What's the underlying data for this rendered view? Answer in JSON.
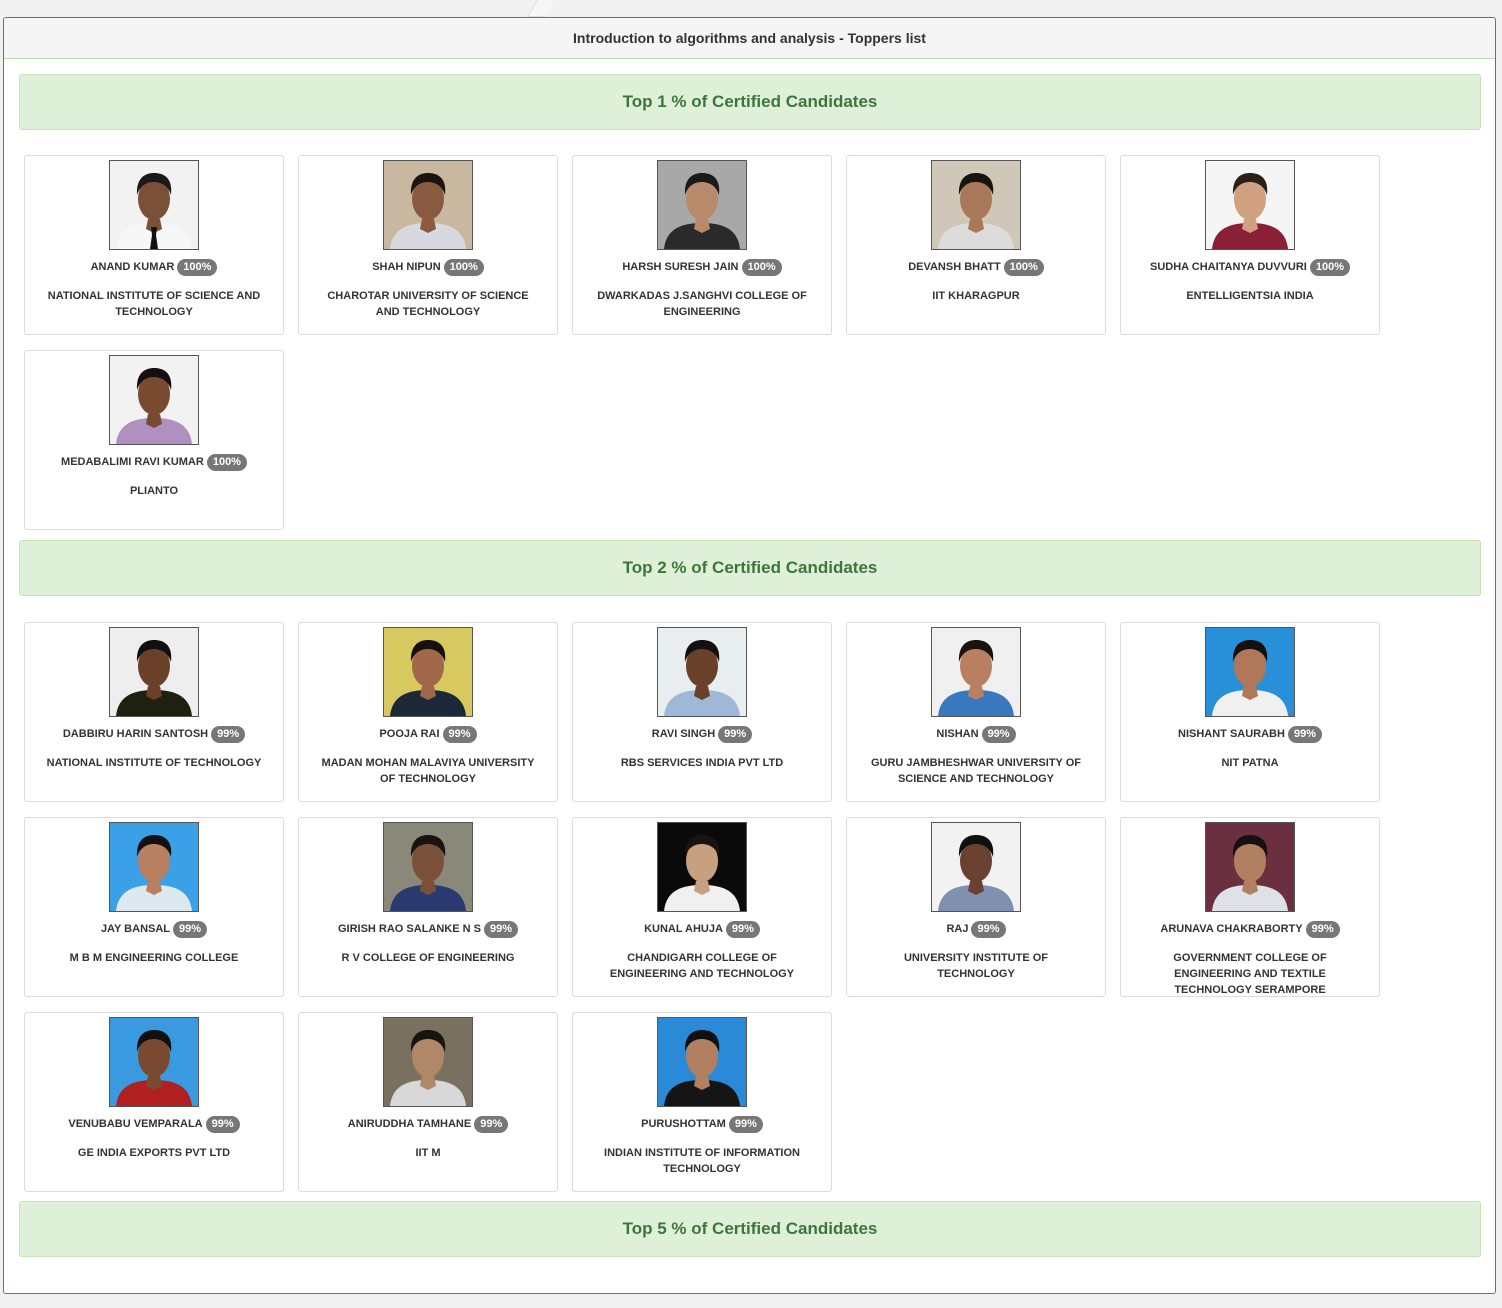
{
  "panel": {
    "title": "Introduction to algorithms and analysis - Toppers list"
  },
  "sections": [
    {
      "title": "Top 1 % of Certified Candidates",
      "candidates": [
        {
          "name": "ANAND KUMAR",
          "score": "100%",
          "org": "NATIONAL INSTITUTE OF SCIENCE AND TECHNOLOGY",
          "photo": {
            "bg": "#f2f2f2",
            "shirt": "#f7f7f7",
            "skin": "#7a5038",
            "hair": "#1a1a1a",
            "tie": true
          }
        },
        {
          "name": "SHAH NIPUN",
          "score": "100%",
          "org": "CHAROTAR UNIVERSITY OF SCIENCE AND TECHNOLOGY",
          "photo": {
            "bg": "#c9b8a0",
            "shirt": "#d8d8e0",
            "skin": "#8a5a40",
            "hair": "#1c1410",
            "tie": false
          }
        },
        {
          "name": "HARSH SURESH JAIN",
          "score": "100%",
          "org": "DWARKADAS J.SANGHVI COLLEGE OF ENGINEERING",
          "photo": {
            "bg": "#a8a8a8",
            "shirt": "#2a2a2a",
            "skin": "#b88a6a",
            "hair": "#1a1a1a",
            "tie": false
          }
        },
        {
          "name": "DEVANSH BHATT",
          "score": "100%",
          "org": "IIT KHARAGPUR",
          "photo": {
            "bg": "#cfc7b8",
            "shirt": "#dcdcdc",
            "skin": "#a87858",
            "hair": "#1a1410",
            "tie": false
          }
        },
        {
          "name": "SUDHA CHAITANYA DUVVURI",
          "score": "100%",
          "org": "ENTELLIGENTSIA INDIA",
          "photo": {
            "bg": "#f5f5f5",
            "shirt": "#8a2035",
            "skin": "#d0a080",
            "hair": "#2a2018",
            "tie": false
          }
        },
        {
          "name": "MEDABALIMI RAVI KUMAR",
          "score": "100%",
          "org": "PLIANTO",
          "photo": {
            "bg": "#f2f2f2",
            "shirt": "#b090c0",
            "skin": "#7a4a30",
            "hair": "#141010",
            "tie": false
          }
        }
      ]
    },
    {
      "title": "Top 2 % of Certified Candidates",
      "candidates": [
        {
          "name": "DABBIRU HARIN SANTOSH",
          "score": "99%",
          "org": "NATIONAL INSTITUTE OF TECHNOLOGY",
          "photo": {
            "bg": "#eeeeee",
            "shirt": "#202010",
            "skin": "#6a4028",
            "hair": "#101010",
            "tie": false
          }
        },
        {
          "name": "POOJA RAI",
          "score": "99%",
          "org": "MADAN MOHAN MALAVIYA UNIVERSITY OF TECHNOLOGY",
          "photo": {
            "bg": "#d8c860",
            "shirt": "#1a2838",
            "skin": "#a06848",
            "hair": "#181010",
            "tie": false
          }
        },
        {
          "name": "RAVI SINGH",
          "score": "99%",
          "org": "RBS SERVICES INDIA PVT LTD",
          "photo": {
            "bg": "#e8eef0",
            "shirt": "#a0b8d8",
            "skin": "#6a4028",
            "hair": "#141010",
            "tie": false
          }
        },
        {
          "name": "NISHAN",
          "score": "99%",
          "org": "GURU JAMBHESHWAR UNIVERSITY OF SCIENCE AND TECHNOLOGY",
          "photo": {
            "bg": "#f0f0f0",
            "shirt": "#3a78c0",
            "skin": "#b88060",
            "hair": "#1a1410",
            "tie": false
          }
        },
        {
          "name": "NISHANT SAURABH",
          "score": "99%",
          "org": "NIT PATNA",
          "photo": {
            "bg": "#2890d8",
            "shirt": "#f0f0f0",
            "skin": "#b07858",
            "hair": "#141010",
            "tie": false
          }
        },
        {
          "name": "JAY BANSAL",
          "score": "99%",
          "org": "M B M ENGINEERING COLLEGE",
          "photo": {
            "bg": "#3aa0e8",
            "shirt": "#dde8f0",
            "skin": "#b88060",
            "hair": "#141010",
            "tie": false
          }
        },
        {
          "name": "GIRISH RAO SALANKE N S",
          "score": "99%",
          "org": "R V COLLEGE OF ENGINEERING",
          "photo": {
            "bg": "#8a8878",
            "shirt": "#2a3a70",
            "skin": "#7a5038",
            "hair": "#181410",
            "tie": false
          }
        },
        {
          "name": "KUNAL AHUJA",
          "score": "99%",
          "org": "CHANDIGARH COLLEGE OF ENGINEERING AND TECHNOLOGY",
          "photo": {
            "bg": "#0a0a0a",
            "shirt": "#f0f0f0",
            "skin": "#c8a080",
            "hair": "#1a1410",
            "tie": false
          }
        },
        {
          "name": "RAJ",
          "score": "99%",
          "org": "UNIVERSITY INSTITUTE OF TECHNOLOGY",
          "photo": {
            "bg": "#f2f2f2",
            "shirt": "#8090b0",
            "skin": "#6a4030",
            "hair": "#101010",
            "tie": false
          }
        },
        {
          "name": "ARUNAVA CHAKRABORTY",
          "score": "99%",
          "org": "GOVERNMENT COLLEGE OF ENGINEERING AND TEXTILE TECHNOLOGY SERAMPORE",
          "photo": {
            "bg": "#6a3040",
            "shirt": "#e0e0e8",
            "skin": "#b08060",
            "hair": "#181010",
            "tie": false
          }
        },
        {
          "name": "VENUBABU VEMPARALA",
          "score": "99%",
          "org": "GE INDIA EXPORTS PVT LTD",
          "photo": {
            "bg": "#3a9ae0",
            "shirt": "#b02020",
            "skin": "#7a4a30",
            "hair": "#101010",
            "tie": false
          }
        },
        {
          "name": "ANIRUDDHA TAMHANE",
          "score": "99%",
          "org": "IIT M",
          "photo": {
            "bg": "#7a7060",
            "shirt": "#d8d8d8",
            "skin": "#b08868",
            "hair": "#181410",
            "tie": false
          }
        },
        {
          "name": "PURUSHOTTAM",
          "score": "99%",
          "org": "INDIAN INSTITUTE OF INFORMATION TECHNOLOGY",
          "photo": {
            "bg": "#2a8ad8",
            "shirt": "#151515",
            "skin": "#b08060",
            "hair": "#101010",
            "tie": false
          }
        }
      ]
    },
    {
      "title": "Top 5 % of Certified Candidates",
      "candidates": []
    }
  ]
}
